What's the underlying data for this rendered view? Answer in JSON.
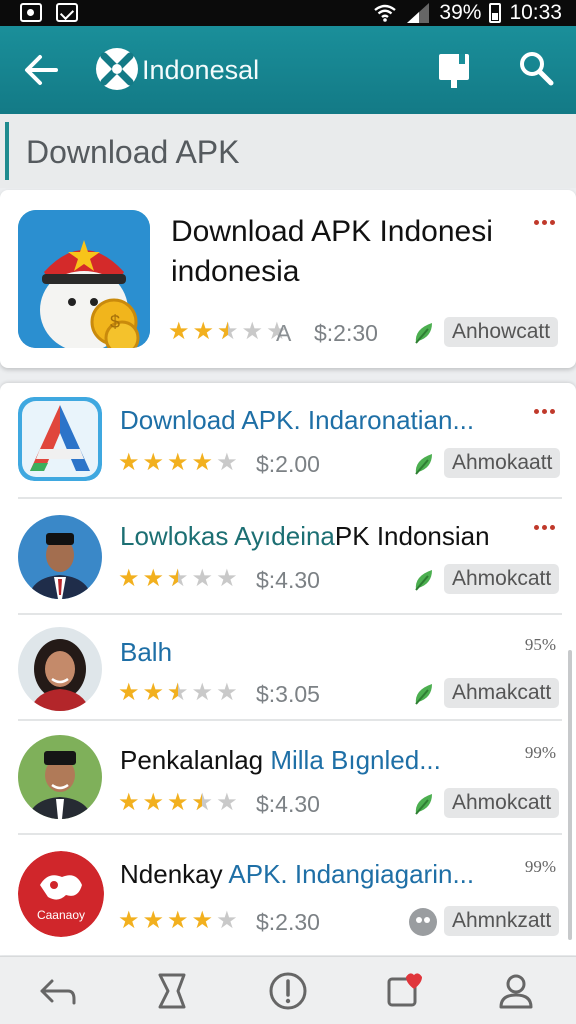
{
  "status_bar": {
    "battery": "39%",
    "time": "10:33"
  },
  "app_bar": {
    "title": "Indonesal"
  },
  "section": {
    "title": "Download APK"
  },
  "featured": {
    "title_line1": "Download APK Indonesi",
    "title_line2": "indonesia",
    "rating": 2.5,
    "letter": "A",
    "price": "$:2:30",
    "tag": "Anhowcatt"
  },
  "apps": [
    {
      "title_parts": [
        {
          "text": "Download APK. Indaronatian...",
          "style": "blue"
        }
      ],
      "rating": 4,
      "price": "$:2.00",
      "tag": "Ahmokaatt",
      "corner": "dots",
      "icon": "a-logo"
    },
    {
      "title_parts": [
        {
          "text": "Lowlokas Ayıdeina",
          "style": "teal"
        },
        {
          "text": "PK Indonsian",
          "style": "dark"
        }
      ],
      "rating": 2.5,
      "price": "$:4.30",
      "tag": "Ahmokcatt",
      "corner": "dots",
      "icon": "man-cap"
    },
    {
      "title_parts": [
        {
          "text": "Balh",
          "style": "blue"
        }
      ],
      "rating": 2.5,
      "price": "$:3.05",
      "tag": "Ahmakcatt",
      "corner": "95%",
      "icon": "woman"
    },
    {
      "title_parts": [
        {
          "text": "Penkalanlag ",
          "style": "dark"
        },
        {
          "text": "Milla Bıgnled...",
          "style": "blue"
        }
      ],
      "rating": 3.5,
      "price": "$:4.30",
      "tag": "Ahmokcatt",
      "corner": "99%",
      "icon": "man-peci"
    },
    {
      "title_parts": [
        {
          "text": "Ndenkay ",
          "style": "dark"
        },
        {
          "text": "APK. Indangiagarin...",
          "style": "blue"
        }
      ],
      "rating": 4,
      "price": "$:2.30",
      "tag": "Ahmnkzatt",
      "corner": "99%",
      "icon": "red-logo"
    }
  ],
  "red_logo_caption": "Caanaoy",
  "icons": {
    "back": "arrow-left-icon",
    "logo": "app-logo-icon",
    "bookmark": "bookmark-icon",
    "search": "search-icon",
    "nav": [
      "back-nav-icon",
      "bookmark-nav-icon",
      "info-icon",
      "favorites-icon",
      "profile-icon"
    ]
  },
  "colors": {
    "appbar": "#1a8f9a",
    "star": "#f2b01e",
    "link_blue": "#1e6fa6",
    "leaf_green": "#4caf50",
    "dots_red": "#c0392b"
  }
}
